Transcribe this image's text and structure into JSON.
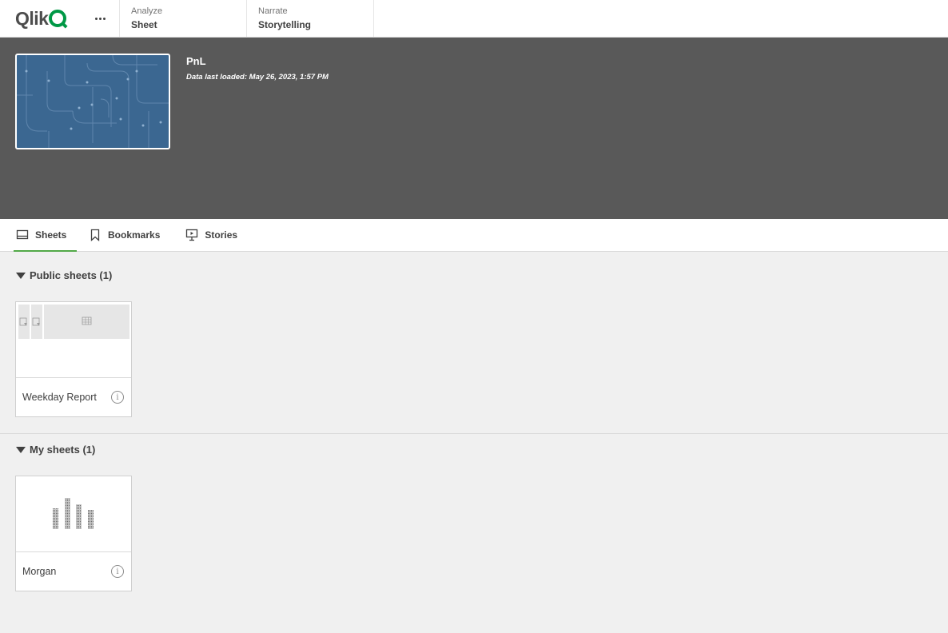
{
  "topbar": {
    "logo_text": "Qlik",
    "more_icon": "more-horizontal-icon",
    "nav": [
      {
        "sub": "Analyze",
        "main": "Sheet"
      },
      {
        "sub": "Narrate",
        "main": "Storytelling"
      }
    ]
  },
  "app": {
    "title": "PnL",
    "loaded": "Data last loaded: May 26, 2023, 1:57 PM"
  },
  "tabs": [
    {
      "label": "Sheets",
      "icon": "sheet-icon",
      "active": true
    },
    {
      "label": "Bookmarks",
      "icon": "bookmark-icon",
      "active": false
    },
    {
      "label": "Stories",
      "icon": "story-icon",
      "active": false
    }
  ],
  "sections": [
    {
      "label": "Public sheets (1)",
      "cards": [
        {
          "title": "Weekday Report"
        }
      ]
    },
    {
      "label": "My sheets (1)",
      "cards": [
        {
          "title": "Morgan"
        }
      ]
    }
  ],
  "colors": {
    "accent": "#52a948",
    "header_bg": "#595959",
    "thumb_bg": "#3b6791"
  }
}
